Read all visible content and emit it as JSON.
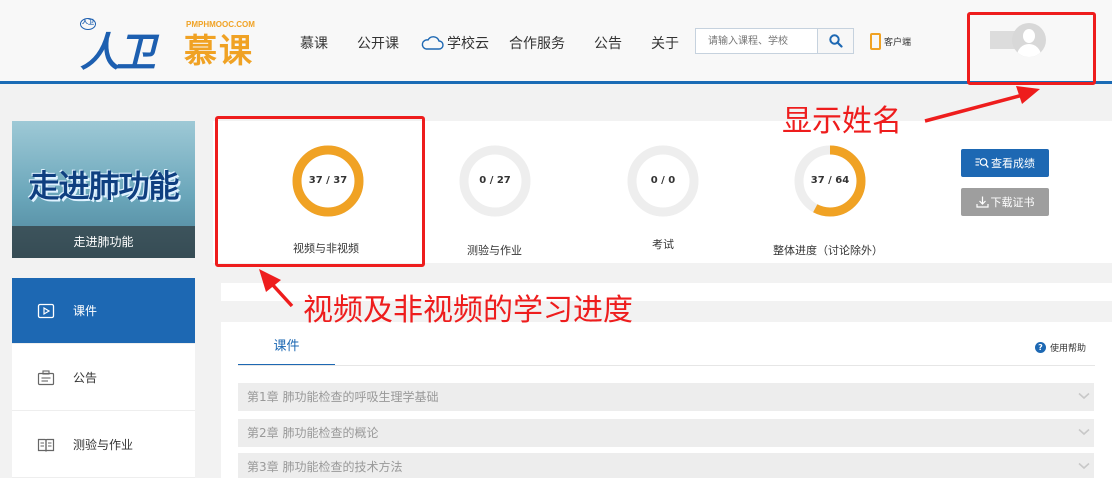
{
  "header": {
    "logo_mark": "人卫",
    "logo_badge": "人卫",
    "logo_muke": "慕课",
    "logo_domain": "PMPHMOOC.COM",
    "nav": [
      {
        "label": "慕课"
      },
      {
        "label": "公开课"
      },
      {
        "label": "学校云",
        "icon": "cloud-icon"
      },
      {
        "label": "合作服务"
      },
      {
        "label": "公告"
      },
      {
        "label": "关于"
      }
    ],
    "search": {
      "placeholder": "请输入课程、学校",
      "icon": "search-icon"
    },
    "client_label": "客户端"
  },
  "annotations": {
    "show_name": "显示姓名",
    "progress_note": "视频及非视频的学习进度",
    "color": "#ee1d1d"
  },
  "course": {
    "cover_title": "走进肺功能",
    "caption": "走进肺功能"
  },
  "sidebar": {
    "items": [
      {
        "label": "课件",
        "icon": "courseware-icon",
        "active": true
      },
      {
        "label": "公告",
        "icon": "announcement-icon",
        "active": false
      },
      {
        "label": "测验与作业",
        "icon": "quiz-book-icon",
        "active": false
      }
    ]
  },
  "progress": [
    {
      "value_text": "37 / 37",
      "done": 37,
      "total": 37,
      "label": "视频与非视频"
    },
    {
      "value_text": "0 / 27",
      "done": 0,
      "total": 27,
      "label": "测验与作业"
    },
    {
      "value_text": "0 / 0",
      "done": 0,
      "total": 0,
      "label": "考试"
    },
    {
      "value_text": "37 / 64",
      "done": 37,
      "total": 64,
      "label": "整体进度（讨论除外）"
    }
  ],
  "actions": {
    "view_scores": "查看成绩",
    "download_certificate": "下载证书"
  },
  "content": {
    "tab": "课件",
    "help": "使用帮助",
    "chapters": [
      "第1章 肺功能检查的呼吸生理学基础",
      "第2章 肺功能检查的概论",
      "第3章 肺功能检查的技术方法"
    ]
  },
  "colors": {
    "brand_blue": "#1d68b3",
    "accent_orange": "#f0a224",
    "ring_track": "#eeeeee"
  }
}
